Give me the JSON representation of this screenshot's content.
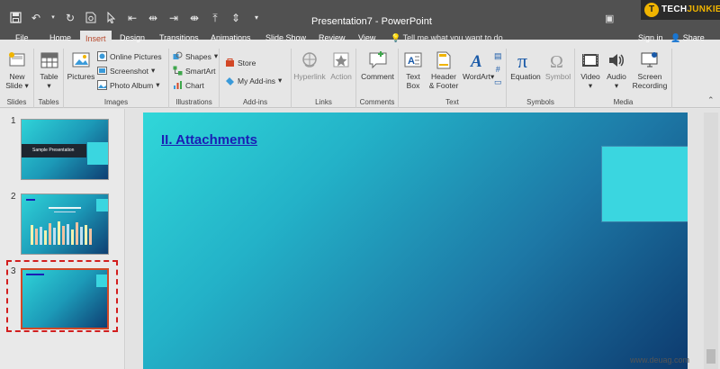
{
  "window": {
    "title": "Presentation7 - PowerPoint",
    "brand_logo": "T",
    "brand_pre": "TECH",
    "brand_post": "JUNKIE"
  },
  "menu": {
    "tabs": [
      "File",
      "Home",
      "Insert",
      "Design",
      "Transitions",
      "Animations",
      "Slide Show",
      "Review",
      "View"
    ],
    "active_tab": "Insert",
    "tell_me": "Tell me what you want to do...",
    "sign_in": "Sign in",
    "share": "Share"
  },
  "ribbon": {
    "slides": {
      "new_slide_1": "New",
      "new_slide_2": "Slide",
      "label": "Slides"
    },
    "tables": {
      "table": "Table",
      "label": "Tables"
    },
    "images": {
      "pictures": "Pictures",
      "online_pictures": "Online Pictures",
      "screenshot": "Screenshot",
      "photo_album": "Photo Album",
      "label": "Images"
    },
    "illustrations": {
      "shapes": "Shapes",
      "smartart": "SmartArt",
      "chart": "Chart",
      "label": "Illustrations"
    },
    "addins": {
      "store": "Store",
      "my_addins": "My Add-ins",
      "label": "Add-ins"
    },
    "links": {
      "hyperlink": "Hyperlink",
      "action": "Action",
      "label": "Links"
    },
    "comments": {
      "comment": "Comment",
      "label": "Comments"
    },
    "text": {
      "textbox_1": "Text",
      "textbox_2": "Box",
      "header_1": "Header",
      "header_2": "& Footer",
      "wordart": "WordArt",
      "label": "Text"
    },
    "symbols": {
      "equation": "Equation",
      "symbol": "Symbol",
      "label": "Symbols"
    },
    "media": {
      "video": "Video",
      "audio": "Audio",
      "screen_1": "Screen",
      "screen_2": "Recording",
      "label": "Media"
    }
  },
  "slides": {
    "numbers": [
      "1",
      "2",
      "3"
    ],
    "thumb1_title": "Sample Presentation"
  },
  "slide": {
    "title": "II. Attachments"
  },
  "watermark": "www.deuag.com",
  "colors": {
    "accent": "#b7472a",
    "selection": "#d21e1e",
    "title_link": "#1a1fb5"
  }
}
